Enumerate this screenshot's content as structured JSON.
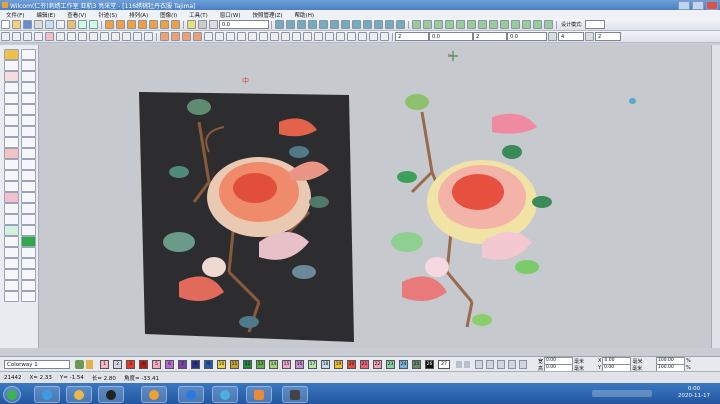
{
  "window": {
    "title": "Wilcom(仁夯)刺绣工作室 亚航3 亮采堂 - [116绣桃牡丹衣服 Tajima]"
  },
  "menu": [
    "文件(F)",
    "编辑(E)",
    "查看(V)",
    "针迹(S)",
    "排列(A)",
    "图像(I)",
    "工具(T)",
    "窗口(W)",
    "快照管理(Z)",
    "帮助(H)"
  ],
  "toolbar": {
    "zoom_value": "0.0",
    "field_a": "2",
    "field_b": "0.0",
    "field_c": "2",
    "field_d": "0.0",
    "field_e": "4",
    "field_f": "2",
    "design_mode_label": "设计模式:"
  },
  "canvas": {
    "marker": "中"
  },
  "colorbar": {
    "colorway_label": "Colorway 1",
    "swatches": [
      {
        "n": "1",
        "c": "#f4b6c8"
      },
      {
        "n": "2",
        "c": "#d7d7ea"
      },
      {
        "n": "3",
        "c": "#e23b2b"
      },
      {
        "n": "4",
        "c": "#b71c1c"
      },
      {
        "n": "5",
        "c": "#f6a9c1"
      },
      {
        "n": "6",
        "c": "#b46ad0"
      },
      {
        "n": "7",
        "c": "#7a3fa8"
      },
      {
        "n": "8",
        "c": "#2c2f8a"
      },
      {
        "n": "9",
        "c": "#1e5aa8"
      },
      {
        "n": "10",
        "c": "#e9d24a"
      },
      {
        "n": "11",
        "c": "#c9a12d"
      },
      {
        "n": "12",
        "c": "#1f8a3a"
      },
      {
        "n": "13",
        "c": "#5fb04e"
      },
      {
        "n": "14",
        "c": "#a7d27c"
      },
      {
        "n": "15",
        "c": "#f0a4d0"
      },
      {
        "n": "16",
        "c": "#c78fd4"
      },
      {
        "n": "17",
        "c": "#b7e4a7"
      },
      {
        "n": "18",
        "c": "#c0e0f0"
      },
      {
        "n": "19",
        "c": "#f0c030"
      },
      {
        "n": "20",
        "c": "#e0503a"
      },
      {
        "n": "21",
        "c": "#e8607a"
      },
      {
        "n": "22",
        "c": "#f4a0b0"
      },
      {
        "n": "23",
        "c": "#8ad0a0"
      },
      {
        "n": "24",
        "c": "#7ab0e0"
      },
      {
        "n": "25",
        "c": "#6a8a6a"
      },
      {
        "n": "26",
        "c": "#111111"
      },
      {
        "n": "27",
        "c": "#ffffff"
      }
    ],
    "coords": [
      {
        "label": "宽",
        "value": "0.00",
        "unit": "毫米"
      },
      {
        "label": "高",
        "value": "0.00",
        "unit": "毫米"
      },
      {
        "label": "X",
        "value": "0.00",
        "unit": "毫米"
      },
      {
        "label": "Y",
        "value": "0.00",
        "unit": "毫米"
      },
      {
        "label": "",
        "value": "100.00",
        "unit": "%"
      },
      {
        "label": "",
        "value": "100.00",
        "unit": "%"
      }
    ]
  },
  "status": {
    "stitch_count": "21442",
    "x": "X=   2.33",
    "y": "Y=  -1.54",
    "len": "长=   2.80",
    "angle": "角度= -33.41"
  },
  "taskbar": {
    "time": "0:00",
    "date": "2020-11-17",
    "apps": [
      {
        "name": "start",
        "c": "#3bb54a"
      },
      {
        "name": "ie",
        "c": "#3b9de0"
      },
      {
        "name": "explorer",
        "c": "#e8b84a"
      },
      {
        "name": "qq",
        "c": "#222"
      },
      {
        "name": "browser",
        "c": "#f0a030"
      },
      {
        "name": "app5",
        "c": "#2a7ae2"
      },
      {
        "name": "app6",
        "c": "#4ab0e0"
      },
      {
        "name": "app7",
        "c": "#e88a3a"
      },
      {
        "name": "app8",
        "c": "#444"
      }
    ]
  }
}
